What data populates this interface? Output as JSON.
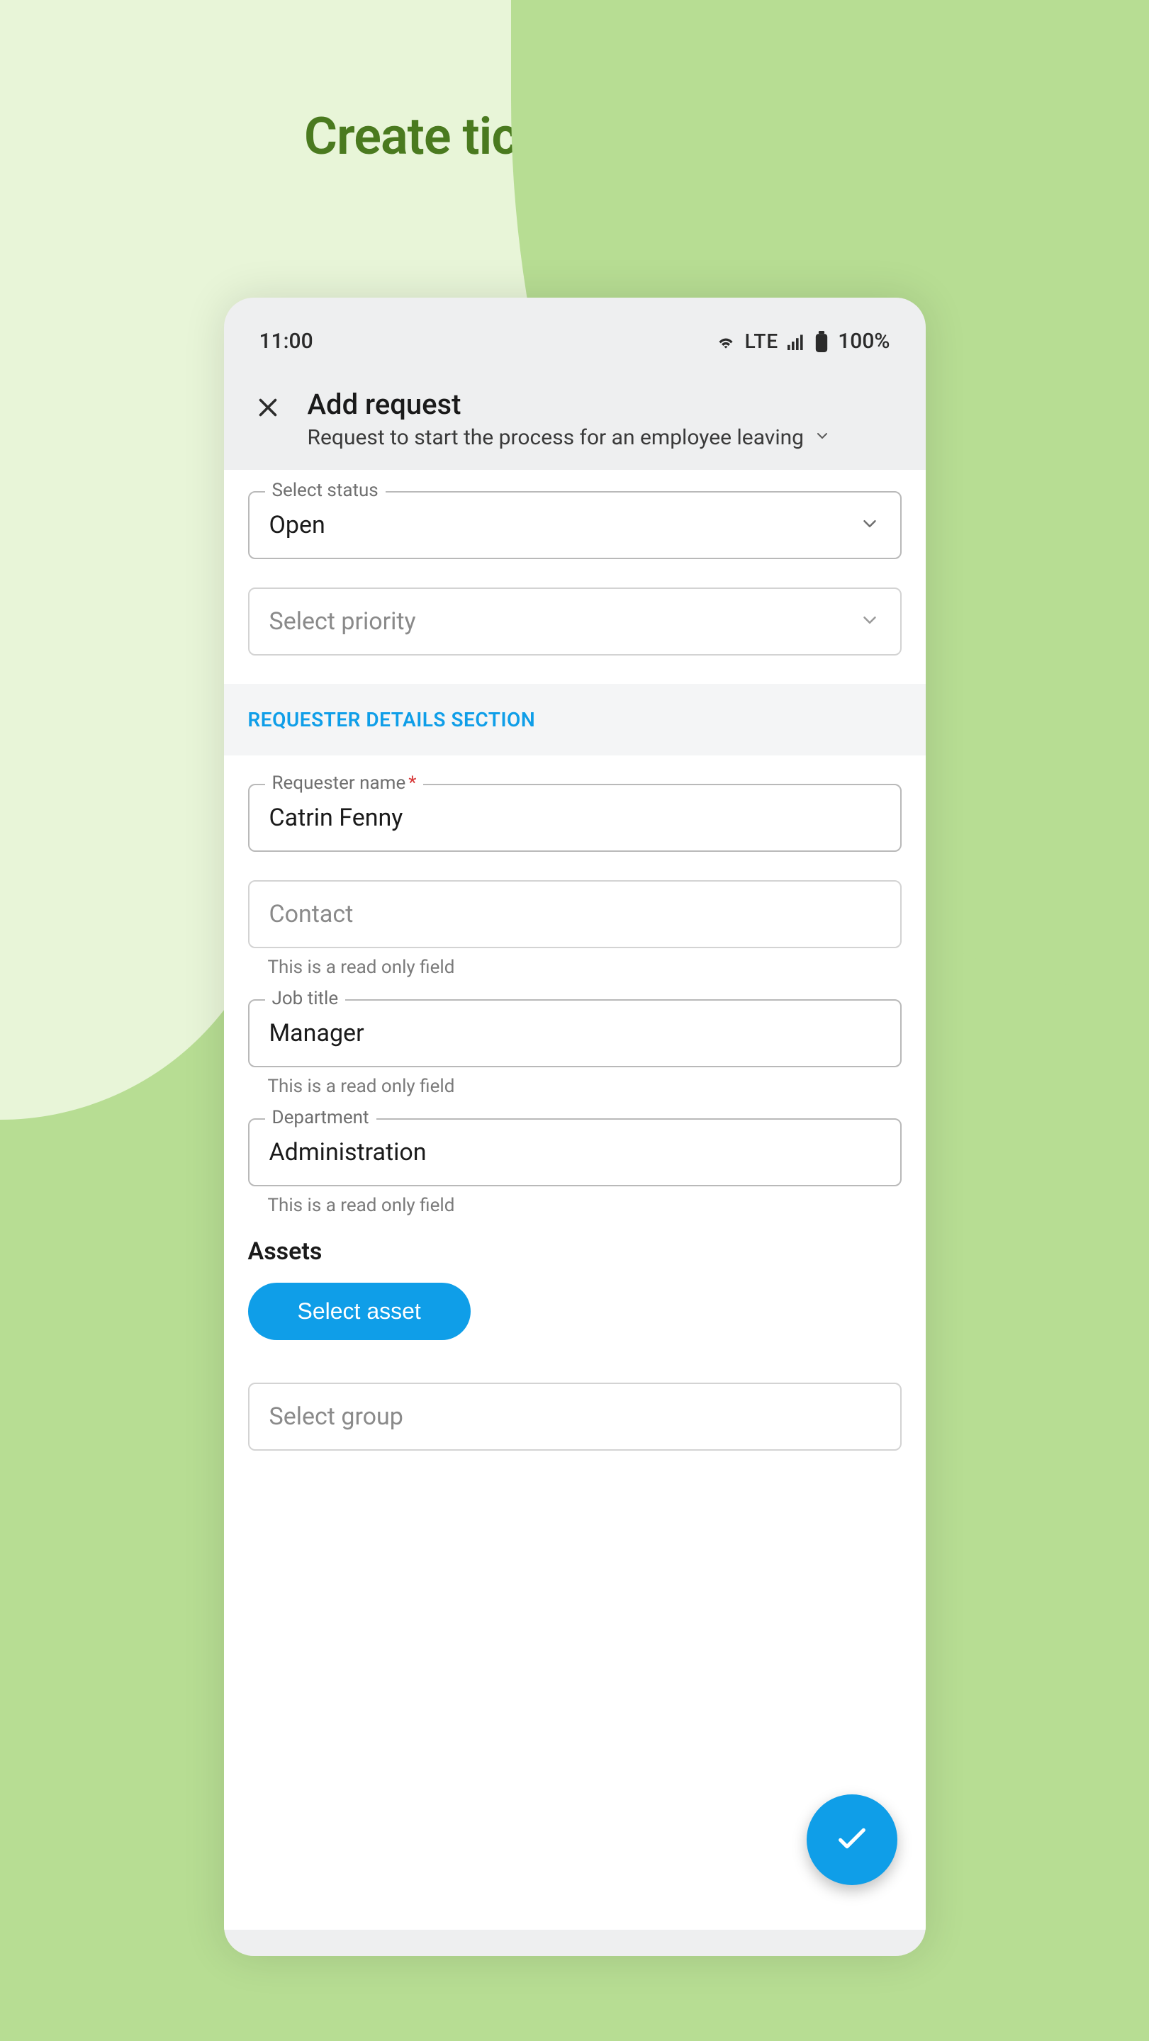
{
  "marketing": {
    "headline": "Create tickets on the go."
  },
  "statusbar": {
    "time": "11:00",
    "network": "LTE",
    "battery": "100%"
  },
  "header": {
    "title": "Add request",
    "subtitle": "Request to start the process for an employee leaving"
  },
  "form": {
    "status": {
      "label": "Select status",
      "value": "Open"
    },
    "priority": {
      "placeholder": "Select priority"
    },
    "requester_section_title": "REQUESTER DETAILS SECTION",
    "requester_name": {
      "label": "Requester name",
      "required_mark": "*",
      "value": "Catrin Fenny"
    },
    "contact": {
      "placeholder": "Contact",
      "helper": "This is a read only field"
    },
    "job_title": {
      "label": "Job title",
      "value": "Manager",
      "helper": "This is a read only field"
    },
    "department": {
      "label": "Department",
      "value": "Administration",
      "helper": "This is a read only field"
    },
    "assets_heading": "Assets",
    "select_asset_btn": "Select asset",
    "group": {
      "placeholder": "Select group"
    }
  }
}
